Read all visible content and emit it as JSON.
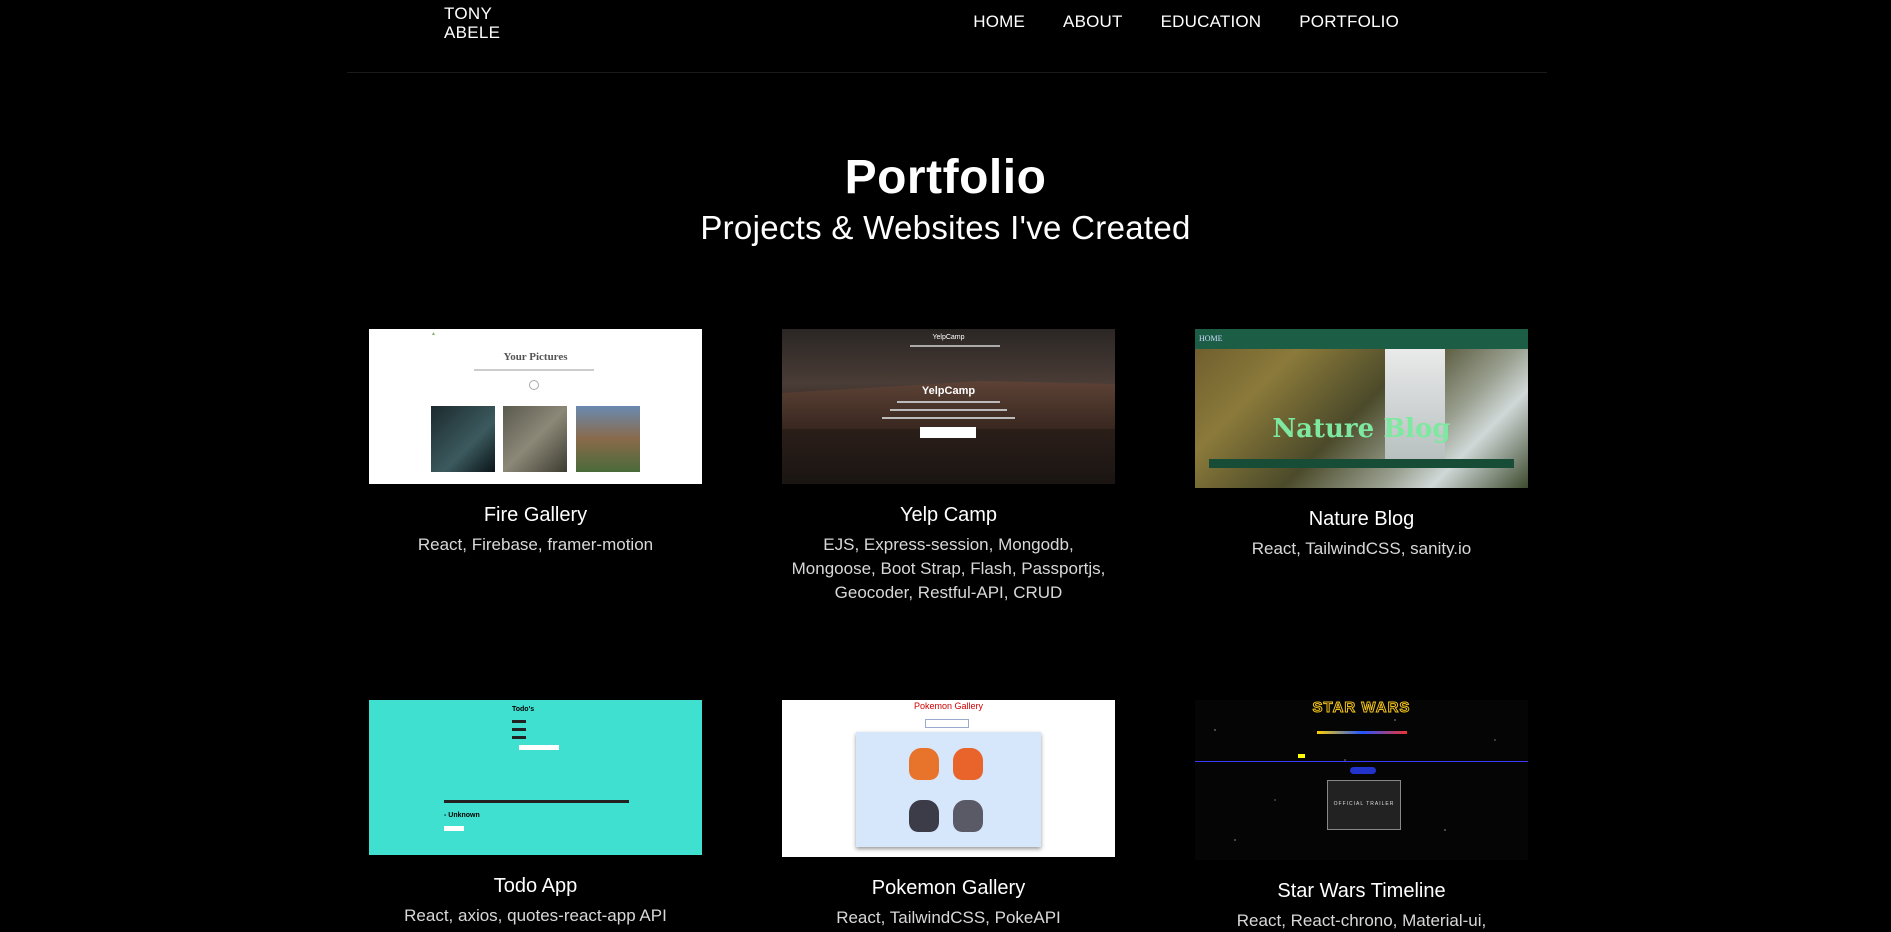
{
  "header": {
    "logo_line1": "TONY",
    "logo_line2": "ABELE",
    "nav": [
      "HOME",
      "ABOUT",
      "EDUCATION",
      "PORTFOLIO"
    ]
  },
  "page": {
    "title": "Portfolio",
    "subtitle": "Projects & Websites I've Created"
  },
  "projects": [
    {
      "title": "Fire Gallery",
      "tech": "React, Firebase, framer-motion",
      "thumb_heading": "Your Pictures"
    },
    {
      "title": "Yelp Camp",
      "tech": "EJS, Express-session, Mongodb, Mongoose, Boot Strap, Flash, Passportjs, Geocoder, Restful-API, CRUD",
      "thumb_nav": "YelpCamp",
      "thumb_heading": "YelpCamp"
    },
    {
      "title": "Nature Blog",
      "tech": "React, TailwindCSS, sanity.io",
      "thumb_nav": "HOME",
      "thumb_heading": "Nature Blog"
    },
    {
      "title": "Todo App",
      "tech": "React, axios, quotes-react-app API",
      "thumb_heading": "Todo's",
      "thumb_quote_author": "- Unknown"
    },
    {
      "title": "Pokemon Gallery",
      "tech": "React, TailwindCSS, PokeAPI",
      "thumb_heading": "Pokemon Gallery"
    },
    {
      "title": "Star Wars Timeline",
      "tech": "React, React-chrono, Material-ui,",
      "thumb_logo": "STAR WARS",
      "thumb_video_label": "OFFICIAL TRAILER"
    }
  ],
  "colors": {
    "background": "#000000",
    "text": "#ffffff",
    "tech_text": "#d8d8d8"
  }
}
